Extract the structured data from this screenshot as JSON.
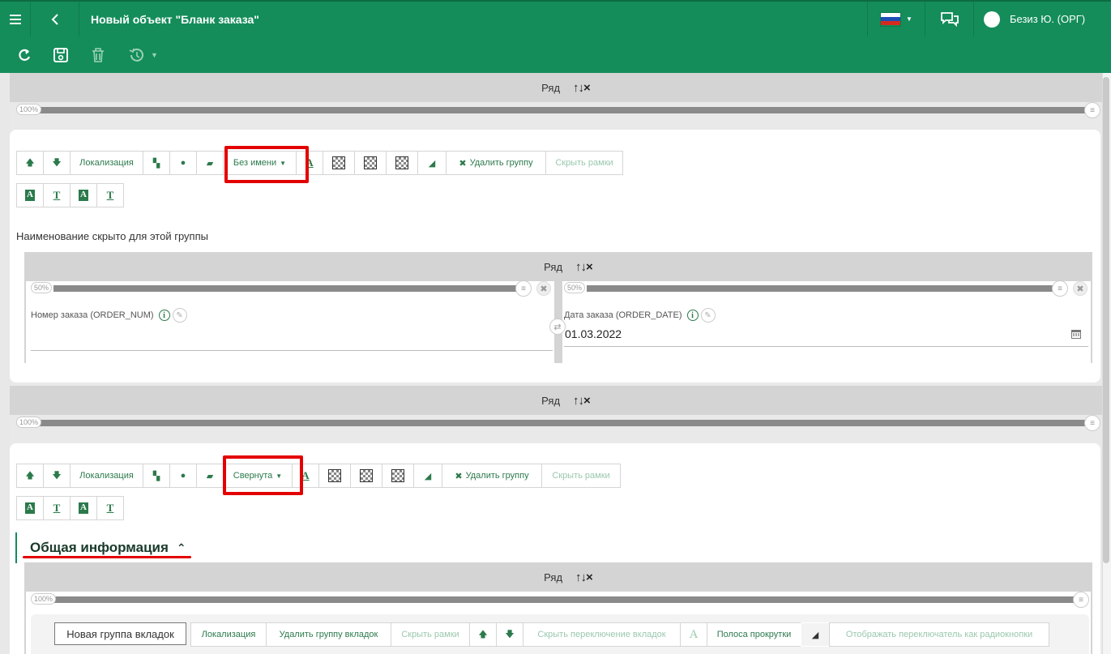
{
  "header": {
    "title": "Новый объект \"Бланк заказа\"",
    "user": "Безиз Ю. (ОРГ)"
  },
  "colors": {
    "brand": "#148d5a",
    "highlight": "#e40000"
  },
  "rows": {
    "label": "Ряд",
    "controls": "↑↓×",
    "pct_100": "100%",
    "pct_50": "50%"
  },
  "group_toolbar": {
    "localization": "Локализация",
    "delete_group": "Удалить группу",
    "hide_borders": "Скрыть рамки"
  },
  "group1": {
    "mode": "Без имени",
    "hidden_note": "Наименование скрыто для этой группы",
    "field_order_num": "Номер заказа (ORDER_NUM)",
    "field_order_date": "Дата заказа (ORDER_DATE)",
    "order_date_value": "01.03.2022"
  },
  "group2": {
    "mode": "Свернута",
    "title": "Общая информация"
  },
  "tabs_toolbar": {
    "new_tab_group": "Новая группа вкладок",
    "localization": "Локализация",
    "delete_tab_group": "Удалить группу вкладок",
    "hide_borders": "Скрыть рамки",
    "hide_tab_switch": "Скрыть переключение вкладок",
    "scrollbar": "Полоса прокрутки",
    "radio_switch": "Отображать переключатель как радиокнопки"
  }
}
